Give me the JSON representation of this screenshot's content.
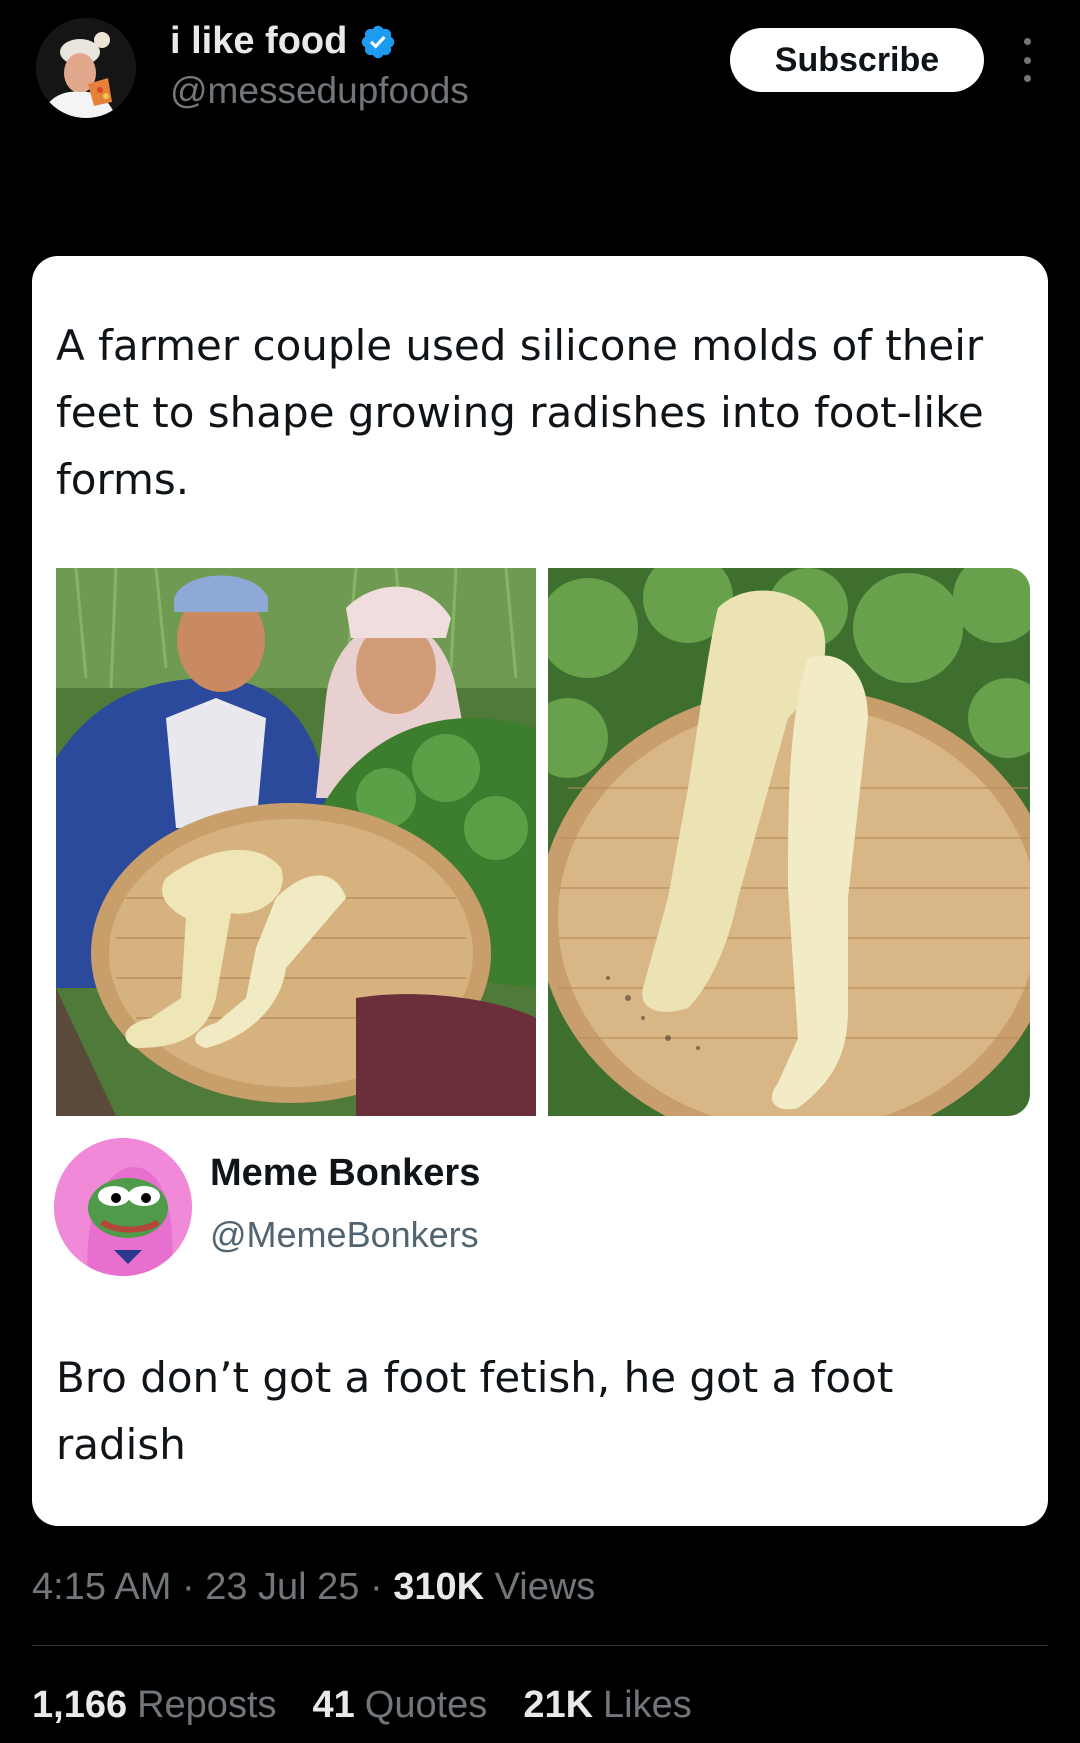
{
  "author": {
    "display_name": "i like food",
    "handle": "@messedupfoods",
    "verified": true,
    "avatar_icon": "chef-avatar"
  },
  "actions": {
    "subscribe_label": "Subscribe",
    "more_icon": "more-vertical-icon"
  },
  "post": {
    "caption": "A farmer couple used silicone molds of their feet to shape growing radishes into foot-like forms.",
    "images": [
      "farmer-couple-with-radish-basket",
      "foot-shaped-radish-on-basket"
    ],
    "quoted": {
      "display_name": "Meme Bonkers",
      "handle": "@MemeBonkers",
      "avatar_icon": "frog-avatar",
      "reply": "Bro don’t got a foot fetish, he got a foot radish"
    }
  },
  "meta": {
    "time": "4:15 AM",
    "date": "23 Jul 25",
    "views_count": "310K",
    "views_label": "Views"
  },
  "stats": {
    "reposts_count": "1,166",
    "reposts_label": "Reposts",
    "quotes_count": "41",
    "quotes_label": "Quotes",
    "likes_count": "21K",
    "likes_label": "Likes"
  },
  "colors": {
    "background": "#000000",
    "card": "#ffffff",
    "verified_blue": "#1d9bf0",
    "muted": "#71767b"
  }
}
